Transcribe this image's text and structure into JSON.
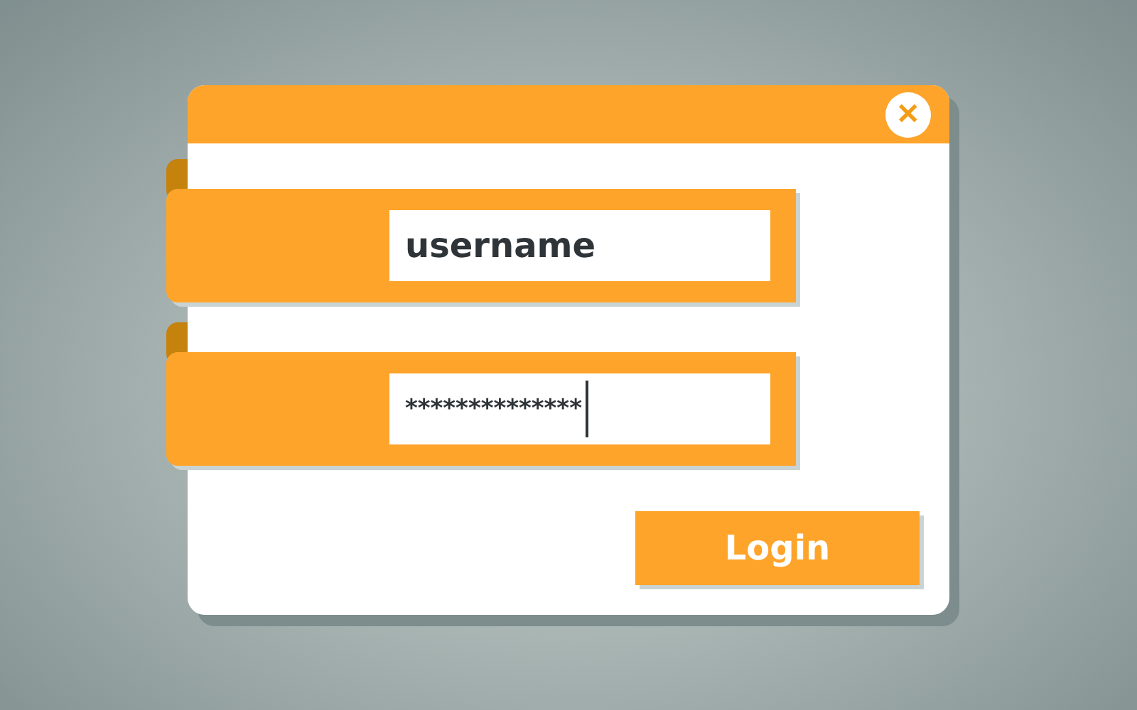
{
  "dialog": {
    "close_button": "✕"
  },
  "fields": [
    {
      "kind": "text",
      "value": "username",
      "focused": false
    },
    {
      "kind": "password",
      "value": "**************",
      "focused": true
    }
  ],
  "login_button": "Login"
}
